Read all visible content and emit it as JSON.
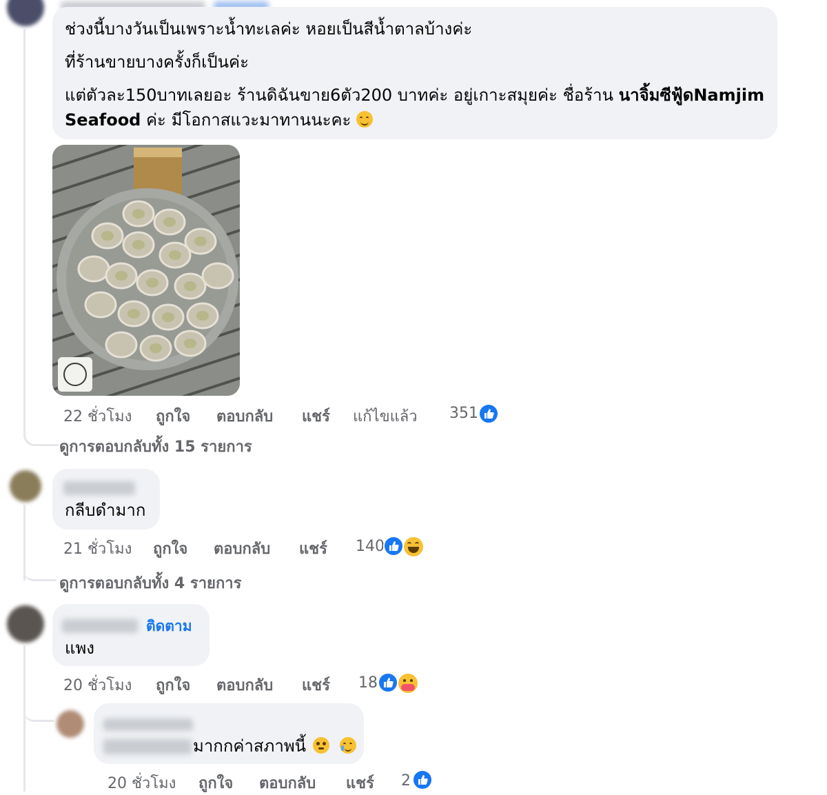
{
  "comments": [
    {
      "text_lines": [
        "ช่วงนี้บางวันเป็นเพราะน้ำทะเลค่ะ หอยเป็นสีน้ำตาลบ้างค่ะ",
        "ที่ร้านขายบางครั้งก็เป็นค่ะ",
        "แต่ตัวละ150บาทเลยอะ ร้านดิฉันขาย6ตัว200 บาทค่ะ อยู่เกาะสมุยค่ะ ชื่อร้าน",
        "นาจิ้มซีฟู้ดNamjim",
        "Seafood",
        "ค่ะ มีโอกาสแวะมาทานนะคะ"
      ],
      "time": "22 ชั่วโมง",
      "like": "ถูกใจ",
      "reply": "ตอบกลับ",
      "share": "แชร์",
      "edited": "แก้ไขแล้ว",
      "reactions": "351",
      "view_replies": "ดูการตอบกลับทั้ง 15 รายการ"
    },
    {
      "text": "กลีบดำมาก",
      "time": "21 ชั่วโมง",
      "like": "ถูกใจ",
      "reply": "ตอบกลับ",
      "share": "แชร์",
      "reactions": "140",
      "view_replies": "ดูการตอบกลับทั้ง 4 รายการ"
    },
    {
      "follow": "ติดตาม",
      "text": "แพง",
      "time": "20 ชั่วโมง",
      "like": "ถูกใจ",
      "reply": "ตอบกลับ",
      "share": "แชร์",
      "reactions": "18"
    },
    {
      "text": "มากกค่าสภาพนี้",
      "time": "20 ชั่วโมง",
      "like": "ถูกใจ",
      "reply": "ตอบกลับ",
      "share": "แชร์",
      "reactions": "2"
    }
  ],
  "colors": {
    "bubble": "#f0f2f5",
    "meta_text": "#65676b",
    "link_blue": "#1877f2",
    "like_blue": "#1877f2",
    "thread_line": "#e4e6eb"
  },
  "icons": [
    "like-reaction-icon",
    "haha-reaction-icon",
    "care-reaction-icon",
    "smiling-emoji-icon",
    "teary-emoji-icon"
  ]
}
